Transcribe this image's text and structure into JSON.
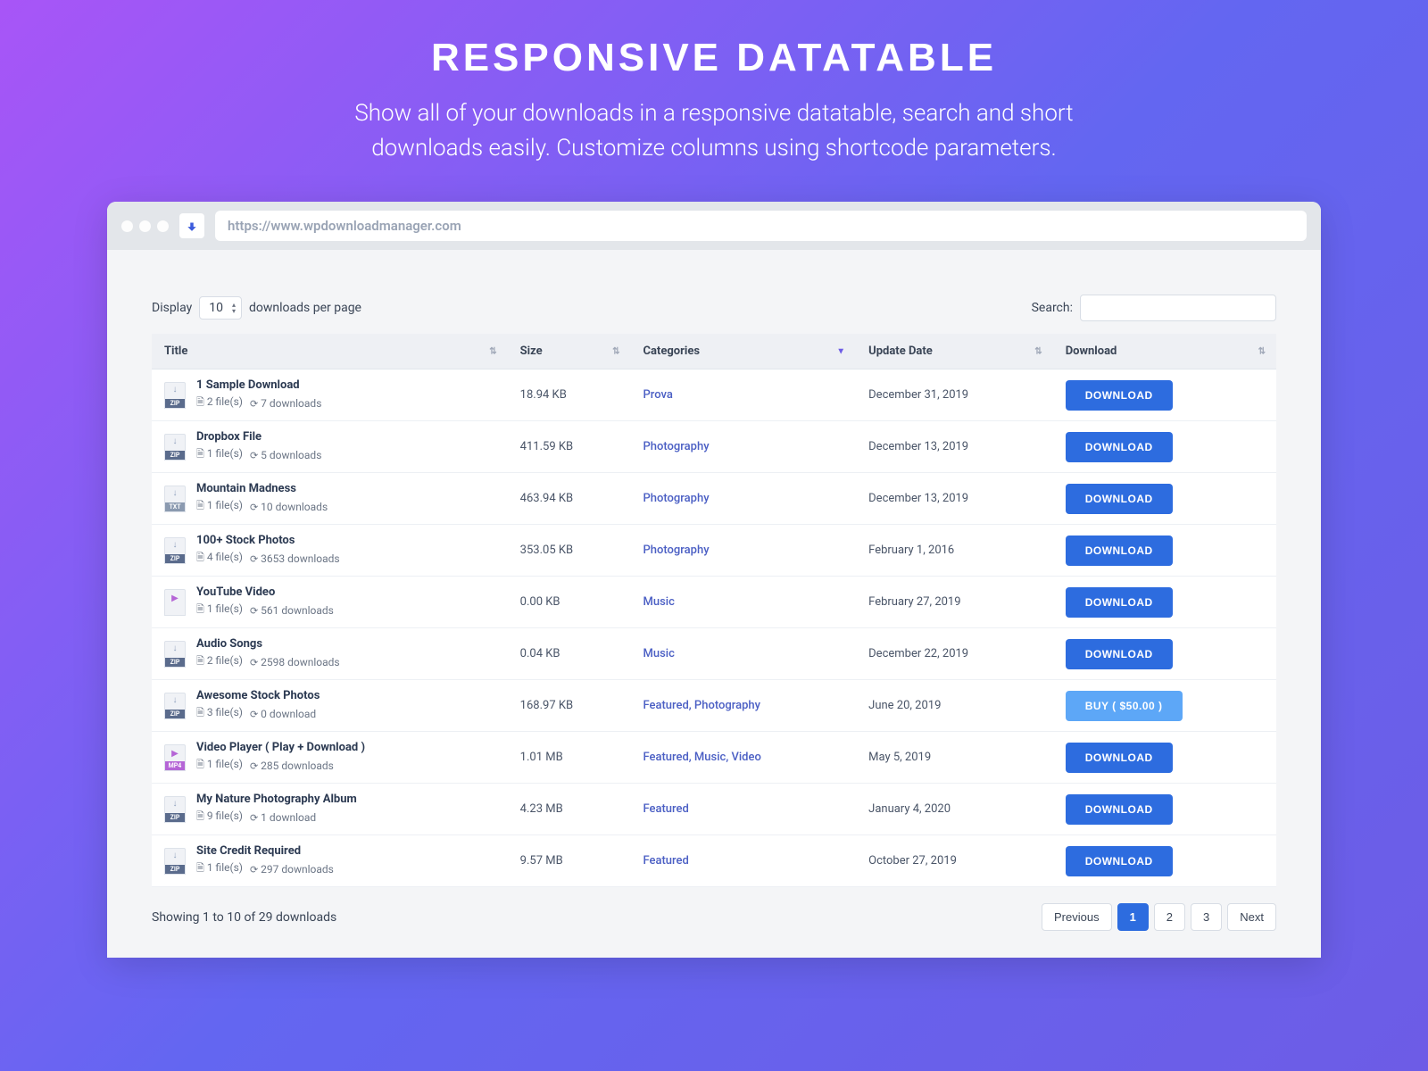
{
  "hero": {
    "title": "RESPONSIVE DATATABLE",
    "subtitle": "Show all of your downloads in a responsive datatable, search and short downloads easily. Customize columns using shortcode parameters."
  },
  "browser": {
    "url": "https://www.wpdownloadmanager.com"
  },
  "controls": {
    "display_label": "Display",
    "per_page": "10",
    "per_page_suffix": "downloads per page",
    "search_label": "Search:"
  },
  "columns": {
    "title": "Title",
    "size": "Size",
    "categories": "Categories",
    "update_date": "Update Date",
    "download": "Download"
  },
  "rows": [
    {
      "ext": "ZIP",
      "title": "1 Sample Download",
      "files": "2 file(s)",
      "downloads": "7 downloads",
      "size": "18.94 KB",
      "categories": "Prova",
      "date": "December 31, 2019",
      "action": "DOWNLOAD",
      "btn_class": "btn-download"
    },
    {
      "ext": "ZIP",
      "title": "Dropbox File",
      "files": "1 file(s)",
      "downloads": "5 downloads",
      "size": "411.59 KB",
      "categories": "Photography",
      "date": "December 13, 2019",
      "action": "DOWNLOAD",
      "btn_class": "btn-download"
    },
    {
      "ext": "TXT",
      "title": "Mountain Madness",
      "files": "1 file(s)",
      "downloads": "10 downloads",
      "size": "463.94 KB",
      "categories": "Photography",
      "date": "December 13, 2019",
      "action": "DOWNLOAD",
      "btn_class": "btn-download"
    },
    {
      "ext": "ZIP",
      "title": "100+ Stock Photos",
      "files": "4 file(s)",
      "downloads": "3653 downloads",
      "size": "353.05 KB",
      "categories": "Photography",
      "date": "February 1, 2016",
      "action": "DOWNLOAD",
      "btn_class": "btn-download"
    },
    {
      "ext": "VID",
      "title": "YouTube Video",
      "files": "1 file(s)",
      "downloads": "561 downloads",
      "size": "0.00 KB",
      "categories": "Music",
      "date": "February 27, 2019",
      "action": "DOWNLOAD",
      "btn_class": "btn-download"
    },
    {
      "ext": "ZIP",
      "title": "Audio Songs",
      "files": "2 file(s)",
      "downloads": "2598 downloads",
      "size": "0.04 KB",
      "categories": "Music",
      "date": "December 22, 2019",
      "action": "DOWNLOAD",
      "btn_class": "btn-download"
    },
    {
      "ext": "ZIP",
      "title": "Awesome Stock Photos",
      "files": "3 file(s)",
      "downloads": "0 download",
      "size": "168.97 KB",
      "categories": "Featured, Photography",
      "date": "June 20, 2019",
      "action": "BUY ( $50.00 )",
      "btn_class": "btn-buy"
    },
    {
      "ext": "MP4",
      "title": "Video Player ( Play + Download )",
      "files": "1 file(s)",
      "downloads": "285 downloads",
      "size": "1.01 MB",
      "categories": "Featured, Music, Video",
      "date": "May 5, 2019",
      "action": "DOWNLOAD",
      "btn_class": "btn-download"
    },
    {
      "ext": "ZIP",
      "title": "My Nature Photography Album",
      "files": "9 file(s)",
      "downloads": "1 download",
      "size": "4.23 MB",
      "categories": "Featured",
      "date": "January 4, 2020",
      "action": "DOWNLOAD",
      "btn_class": "btn-download"
    },
    {
      "ext": "ZIP",
      "title": "Site Credit Required",
      "files": "1 file(s)",
      "downloads": "297 downloads",
      "size": "9.57 MB",
      "categories": "Featured",
      "date": "October 27, 2019",
      "action": "DOWNLOAD",
      "btn_class": "btn-download"
    }
  ],
  "footer": {
    "showing": "Showing 1 to 10 of 29 downloads",
    "prev": "Previous",
    "pages": [
      "1",
      "2",
      "3"
    ],
    "next": "Next",
    "active_page": "1"
  }
}
